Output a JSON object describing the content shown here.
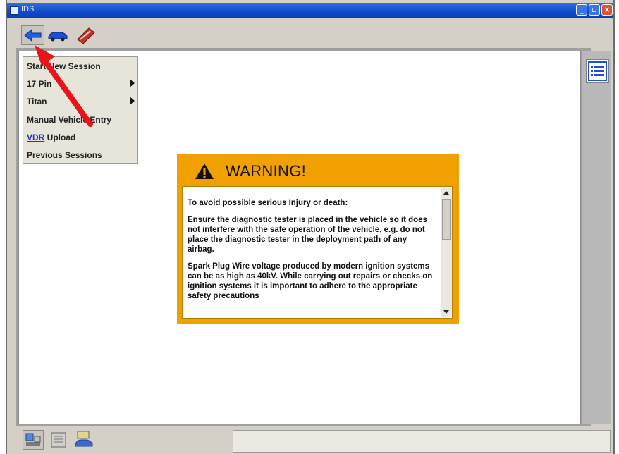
{
  "window": {
    "title": "IDS"
  },
  "toolbar": {
    "icons": [
      "back-arrow-icon",
      "vehicle-icon",
      "toolbox-icon"
    ]
  },
  "menu": {
    "items": [
      {
        "label": "Start New Session",
        "submenu": false
      },
      {
        "label": "17 Pin",
        "submenu": true
      },
      {
        "label": "Titan",
        "submenu": true
      },
      {
        "label": "Manual Vehicle Entry",
        "submenu": false
      },
      {
        "label_link": "VDR",
        "label_rest": " Upload",
        "submenu": false
      },
      {
        "label": "Previous Sessions",
        "submenu": false
      }
    ]
  },
  "warning": {
    "title": "WARNING!",
    "paragraphs": [
      "To avoid possible serious Injury or death:",
      "Ensure the diagnostic tester is placed in the vehicle so it does not interfere with the safe operation of the vehicle, e.g. do not place the diagnostic tester in the deployment path of any airbag.",
      "Spark Plug Wire voltage produced by modern ignition systems can be as high as 40kV. While carrying out repairs or checks on ignition systems it is important to adhere to the appropriate safety precautions"
    ]
  },
  "colors": {
    "warning_bg": "#f0a000",
    "titlebar": "#0f49c9",
    "annotation_arrow": "#e8141a"
  },
  "bottom_toolbar": {
    "icons": [
      "vehicle-data-icon",
      "notepad-icon",
      "car-connect-icon"
    ]
  }
}
